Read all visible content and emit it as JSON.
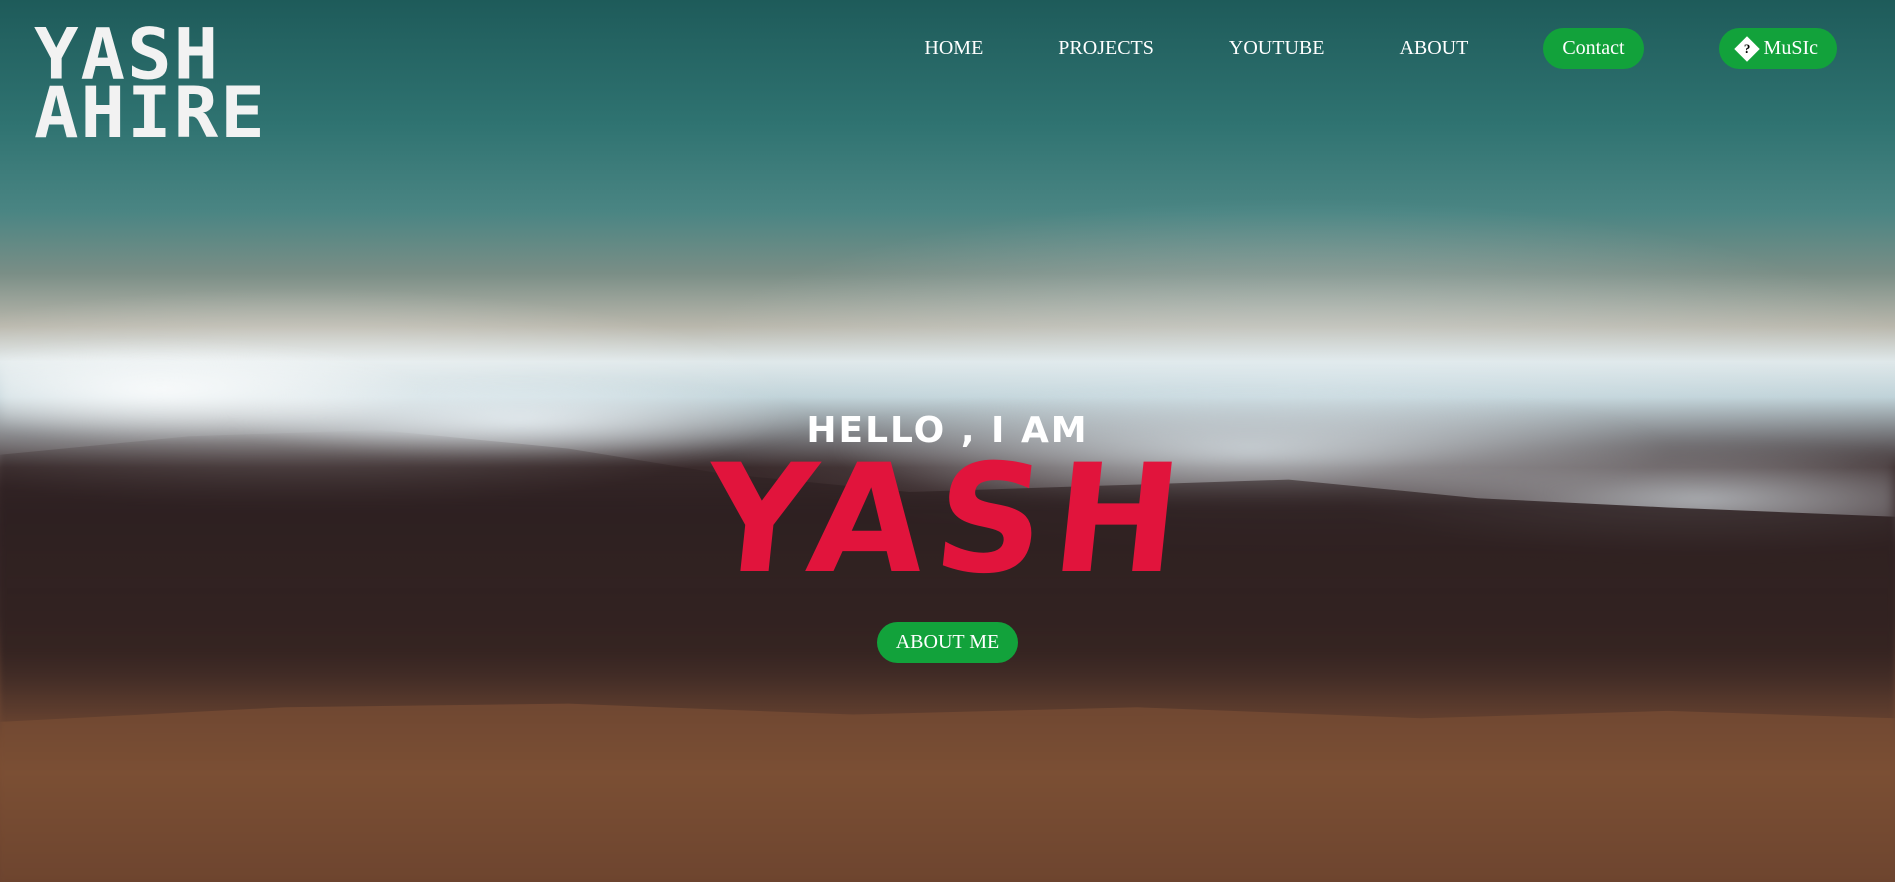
{
  "logo": {
    "line1": "YASH",
    "line2": "AHIRE"
  },
  "nav": {
    "items": [
      {
        "label": "HOME"
      },
      {
        "label": "PROJECTS"
      },
      {
        "label": "YOUTUBE"
      },
      {
        "label": "ABOUT"
      }
    ],
    "contact_label": "Contact",
    "music_label": "MuSIc",
    "music_icon_glyph": "?"
  },
  "hero": {
    "greeting": "HELLO , I AM",
    "name": "YASH",
    "about_button_label": "ABOUT ME"
  },
  "colors": {
    "accent_green": "#12a23b",
    "name_red": "#e1143c",
    "text_white": "#ffffff"
  },
  "icons": {
    "music": "music-icon"
  }
}
